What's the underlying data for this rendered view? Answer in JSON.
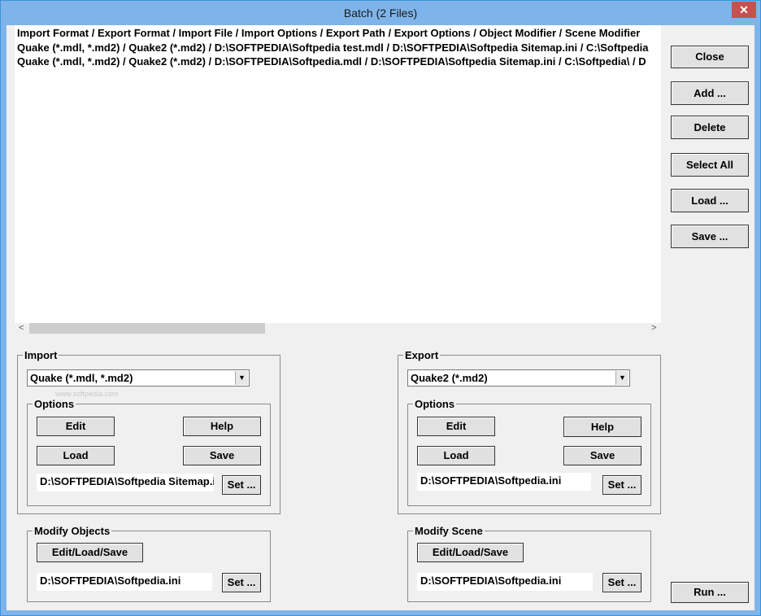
{
  "window": {
    "title": "Batch (2 Files)"
  },
  "list": {
    "header": "Import Format / Export Format / Import File / Import Options / Export Path / Export Options / Object Modifier / Scene Modifier",
    "rows": [
      "Quake (*.mdl, *.md2) / Quake2 (*.md2) / D:\\SOFTPEDIA\\Softpedia test.mdl / D:\\SOFTPEDIA\\Softpedia Sitemap.ini / C:\\Softpedia",
      "Quake (*.mdl, *.md2) / Quake2 (*.md2) / D:\\SOFTPEDIA\\Softpedia.mdl / D:\\SOFTPEDIA\\Softpedia Sitemap.ini / C:\\Softpedia\\ / D"
    ]
  },
  "side_buttons": {
    "close": "Close",
    "add": "Add ...",
    "delete": "Delete",
    "select_all": "Select All",
    "load": "Load ...",
    "save": "Save ...",
    "run": "Run ..."
  },
  "import": {
    "label": "Import",
    "format": "Quake (*.mdl, *.md2)",
    "options_label": "Options",
    "edit": "Edit",
    "help": "Help",
    "load": "Load",
    "save": "Save",
    "path": "D:\\SOFTPEDIA\\Softpedia Sitemap.ini",
    "set": "Set ..."
  },
  "export": {
    "label": "Export",
    "format": "Quake2 (*.md2)",
    "options_label": "Options",
    "edit": "Edit",
    "help": "Help",
    "load": "Load",
    "save": "Save",
    "path": "D:\\SOFTPEDIA\\Softpedia.ini",
    "set": "Set ..."
  },
  "modify_objects": {
    "label": "Modify Objects",
    "button": "Edit/Load/Save",
    "path": "D:\\SOFTPEDIA\\Softpedia.ini",
    "set": "Set ..."
  },
  "modify_scene": {
    "label": "Modify Scene",
    "button": "Edit/Load/Save",
    "path": "D:\\SOFTPEDIA\\Softpedia.ini",
    "set": "Set ..."
  },
  "watermark": "www.softpedia.com",
  "icons": {
    "close": "close-icon",
    "dropdown": "chevron-down-icon",
    "scroll_left": "chevron-left-icon",
    "scroll_right": "chevron-right-icon"
  }
}
